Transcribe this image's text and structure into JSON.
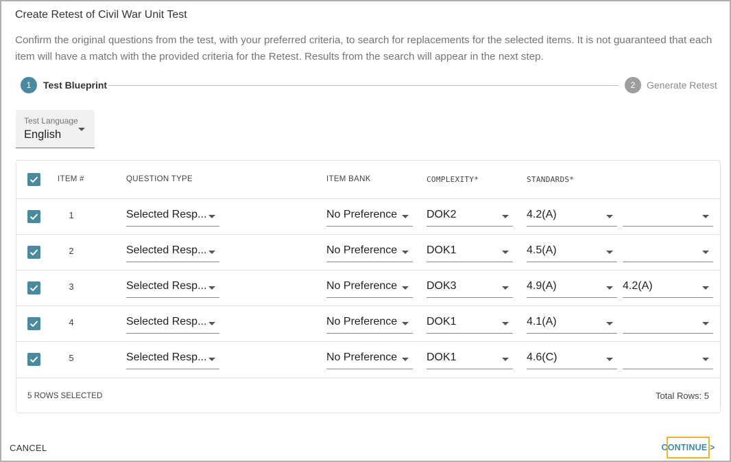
{
  "dialog": {
    "title": "Create Retest of Civil War Unit Test",
    "description": "Confirm the original questions from the test, with your preferred criteria, to search for replacements for the selected items. It is not guaranteed that each item will have a match with the provided criteria for the Retest. Results from the search will appear in the next step."
  },
  "stepper": {
    "steps": [
      {
        "number": "1",
        "label": "Test Blueprint",
        "active": true
      },
      {
        "number": "2",
        "label": "Generate Retest",
        "active": false
      }
    ]
  },
  "language_select": {
    "label": "Test Language",
    "value": "English"
  },
  "table": {
    "headers": {
      "item": "ITEM #",
      "question_type": "QUESTION TYPE",
      "item_bank": "ITEM BANK",
      "complexity": "COMPLEXITY*",
      "standards": "STANDARDS*"
    },
    "rows": [
      {
        "item": "1",
        "question_type": "Selected Resp...",
        "item_bank": "No Preference",
        "complexity": "DOK2",
        "standard1": "4.2(A)",
        "standard2": ""
      },
      {
        "item": "2",
        "question_type": "Selected Resp...",
        "item_bank": "No Preference",
        "complexity": "DOK1",
        "standard1": "4.5(A)",
        "standard2": ""
      },
      {
        "item": "3",
        "question_type": "Selected Resp...",
        "item_bank": "No Preference",
        "complexity": "DOK3",
        "standard1": "4.9(A)",
        "standard2": "4.2(A)"
      },
      {
        "item": "4",
        "question_type": "Selected Resp...",
        "item_bank": "No Preference",
        "complexity": "DOK1",
        "standard1": "4.1(A)",
        "standard2": ""
      },
      {
        "item": "5",
        "question_type": "Selected Resp...",
        "item_bank": "No Preference",
        "complexity": "DOK1",
        "standard1": "4.6(C)",
        "standard2": ""
      }
    ],
    "footer": {
      "rows_selected": "5 ROWS SELECTED",
      "total_rows": "Total Rows: 5"
    }
  },
  "actions": {
    "cancel": "CANCEL",
    "continue": "CONTINUE >"
  },
  "colors": {
    "accent": "#4a8a9e",
    "link": "#3b8bad",
    "focus": "#f0b323"
  }
}
